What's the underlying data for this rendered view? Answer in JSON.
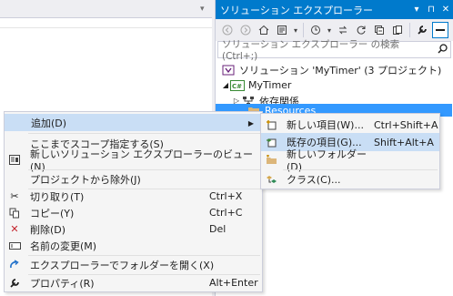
{
  "solution_explorer": {
    "title": "ソリューション エクスプローラー",
    "title_buttons": [
      "▾",
      "⊓",
      "✕"
    ],
    "search_placeholder": "ソリューション エクスプローラー の検索 (Ctrl+;)",
    "tree": {
      "solution": "ソリューション 'MyTimer' (3 プロジェクト)",
      "project": "MyTimer",
      "dependencies": "依存関係",
      "resources": "Resources"
    }
  },
  "context_menu": {
    "add": "追加(D)",
    "scope": "ここまでスコープ指定する(S)",
    "new_view": "新しいソリューション エクスプローラーのビュー(N)",
    "exclude": "プロジェクトから除外(J)",
    "cut": "切り取り(T)",
    "cut_shortcut": "Ctrl+X",
    "copy": "コピー(Y)",
    "copy_shortcut": "Ctrl+C",
    "delete": "削除(D)",
    "delete_shortcut": "Del",
    "rename": "名前の変更(M)",
    "open_folder": "エクスプローラーでフォルダーを開く(X)",
    "properties": "プロパティ(R)",
    "properties_shortcut": "Alt+Enter"
  },
  "submenu": {
    "new_item": "新しい項目(W)...",
    "new_item_shortcut": "Ctrl+Shift+A",
    "existing_item": "既存の項目(G)...",
    "existing_item_shortcut": "Shift+Alt+A",
    "new_folder": "新しいフォルダー(D)",
    "class": "クラス(C)..."
  },
  "colors": {
    "title_bar": "#007acc",
    "selection": "#3399ff",
    "menu_highlight": "#c9def5"
  }
}
